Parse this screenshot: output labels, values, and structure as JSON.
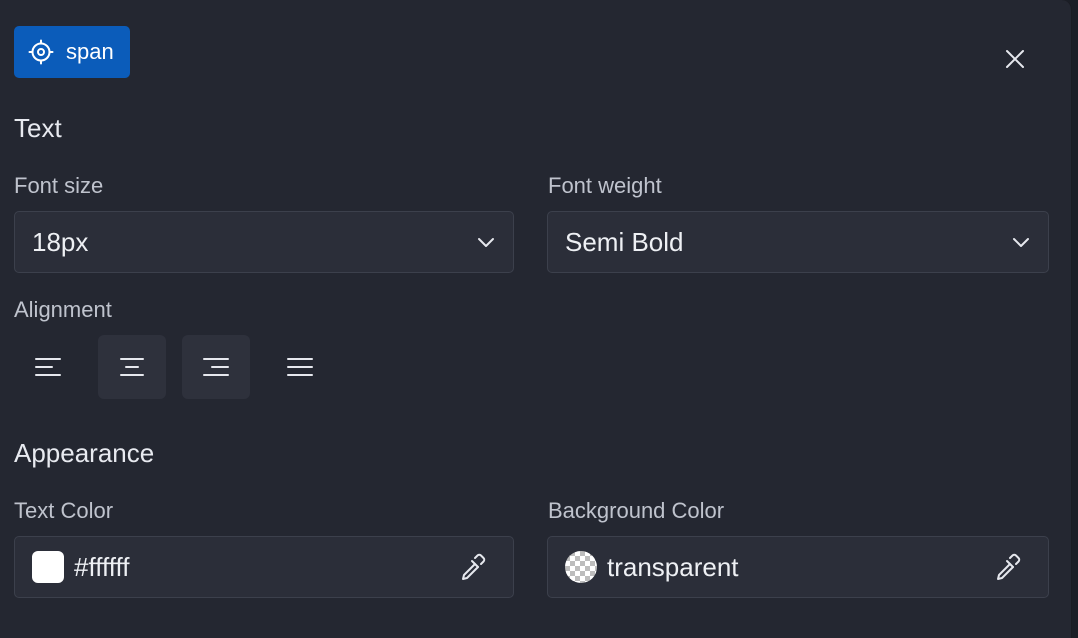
{
  "element_tag": {
    "label": "span",
    "icon": "target-icon",
    "color": "#0b5cba"
  },
  "close": {
    "icon": "close-icon"
  },
  "text_section": {
    "title": "Text",
    "font_size": {
      "label": "Font size",
      "value": "18px"
    },
    "font_weight": {
      "label": "Font weight",
      "value": "Semi Bold"
    },
    "alignment": {
      "label": "Alignment",
      "options": [
        {
          "name": "left",
          "icon": "align-left-icon"
        },
        {
          "name": "center",
          "icon": "align-center-icon"
        },
        {
          "name": "right",
          "icon": "align-right-icon"
        },
        {
          "name": "justify",
          "icon": "align-justify-icon"
        }
      ]
    }
  },
  "appearance_section": {
    "title": "Appearance",
    "text_color": {
      "label": "Text Color",
      "value": "#ffffff",
      "swatch": "#ffffff",
      "icon": "eyedropper-icon"
    },
    "background_color": {
      "label": "Background Color",
      "value": "transparent",
      "icon": "eyedropper-icon"
    }
  }
}
